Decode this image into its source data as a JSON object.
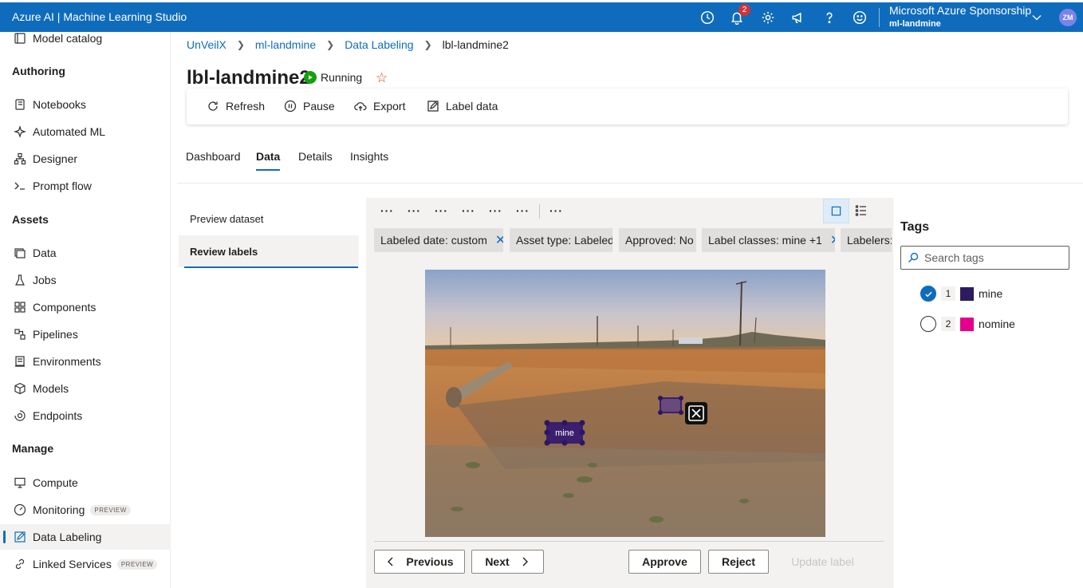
{
  "topbar": {
    "brand": "Azure AI | Machine Learning Studio",
    "notification_count": "2",
    "subscription": "Microsoft Azure Sponsorship",
    "workspace": "ml-landmine",
    "avatar_initials": "ZM",
    "accent": "#0f6cbd"
  },
  "sidebar": {
    "top_item": "Model catalog",
    "section_authoring": "Authoring",
    "authoring": [
      "Notebooks",
      "Automated ML",
      "Designer",
      "Prompt flow"
    ],
    "section_assets": "Assets",
    "assets": [
      "Data",
      "Jobs",
      "Components",
      "Pipelines",
      "Environments",
      "Models",
      "Endpoints"
    ],
    "section_manage": "Manage",
    "manage": [
      "Compute",
      "Monitoring",
      "Data Labeling",
      "Linked Services"
    ],
    "preview_badge": "PREVIEW",
    "active": "Data Labeling"
  },
  "breadcrumbs": [
    "UnVeilX",
    "ml-landmine",
    "Data Labeling",
    "lbl-landmine2"
  ],
  "page": {
    "title": "lbl-landmine2",
    "status": "Running",
    "status_color": "#13a10e"
  },
  "toolbar": {
    "refresh": "Refresh",
    "pause": "Pause",
    "export": "Export",
    "label_data": "Label data"
  },
  "tabs": [
    "Dashboard",
    "Data",
    "Details",
    "Insights"
  ],
  "active_tab": "Data",
  "subnav": [
    "Preview dataset",
    "Review labels"
  ],
  "active_subnav": "Review labels",
  "toolbar_dots": [
    "···",
    "···",
    "···",
    "···",
    "···",
    "···",
    "···"
  ],
  "filters": [
    {
      "label": "Labeled date: custom",
      "removable": true
    },
    {
      "label": "Asset type: Labeled",
      "removable": false
    },
    {
      "label": "Approved: No",
      "removable": false
    },
    {
      "label": "Label classes: mine +1",
      "removable": true
    },
    {
      "label": "Labelers:",
      "removable": false
    }
  ],
  "annotations": [
    {
      "label": "mine",
      "color": "#3b1f6e"
    }
  ],
  "buttons": {
    "previous": "Previous",
    "next": "Next",
    "approve": "Approve",
    "reject": "Reject",
    "update_label": "Update label"
  },
  "tags": {
    "title": "Tags",
    "search_placeholder": "Search tags",
    "items": [
      {
        "num": "1",
        "name": "mine",
        "color": "#2e1a5e",
        "selected": true
      },
      {
        "num": "2",
        "name": "nomine",
        "color": "#e3008c",
        "selected": false
      }
    ]
  }
}
